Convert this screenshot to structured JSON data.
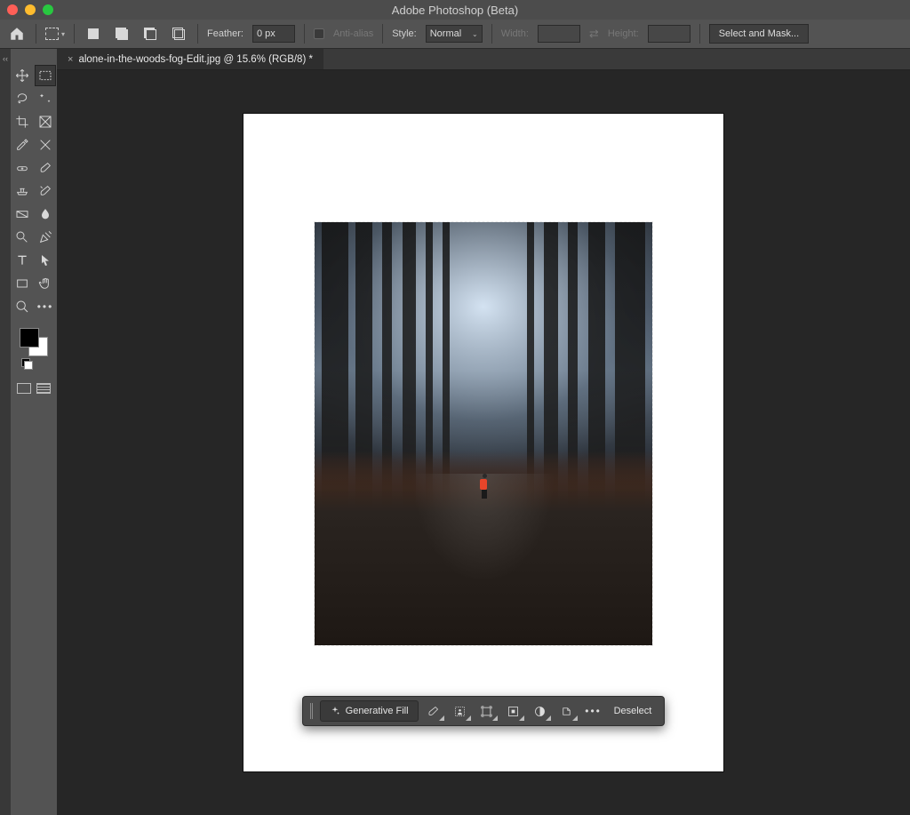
{
  "app_title": "Adobe Photoshop (Beta)",
  "options": {
    "feather_label": "Feather:",
    "feather_value": "0 px",
    "antialias_label": "Anti-alias",
    "style_label": "Style:",
    "style_value": "Normal",
    "width_label": "Width:",
    "height_label": "Height:",
    "select_and_mask": "Select and Mask..."
  },
  "document": {
    "tab_title": "alone-in-the-woods-fog-Edit.jpg @ 15.6% (RGB/8) *"
  },
  "taskbar": {
    "generative_fill": "Generative Fill",
    "deselect": "Deselect",
    "more": "•••"
  },
  "colors": {
    "foreground": "#000000",
    "background": "#ffffff"
  }
}
